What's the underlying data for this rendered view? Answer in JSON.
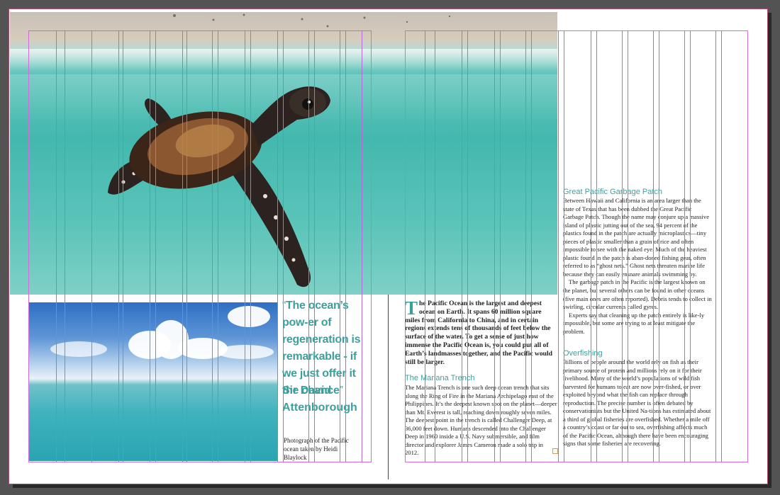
{
  "colors": {
    "accent": "#3d9f9c",
    "pasteboard": "#535353",
    "guides": "#b26ad8"
  },
  "quote": {
    "open": "“",
    "text": "The ocean’s pow-er of regeneration is remarkable - if we just offer it the chance",
    "close": "”",
    "author": "Sir David Attenborough"
  },
  "caption": "Photograph of the Pacific ocean taken by Heidi Blaylock",
  "intro": {
    "dropcap": "T",
    "text": "he Pacific Ocean is the largest and deepest ocean on Earth. It spans 60 million square miles from California to China, and in certain regions extends tens of thousands of feet below the surface of the water. To get a sense of just how immense the Pacific Ocean is, you could put all of Earth’s landmasses together, and the Pacific would still be larger."
  },
  "sections": {
    "mariana": {
      "heading": "The Mariana Trench",
      "body": "The Mariana Trench is one such deep ocean trench that sits along the Ring of Fire in the Mariana Archipelago east of the Philippines. It’s the deepest known spot on the planet—deeper than Mt. Everest is tall, reaching down roughly seven miles. The deepest point in the trench is called Challenger Deep, at 36,000 feet down. Humans descended into the Challenger Deep in 1960 inside a U.S. Navy submersible, and film director and explorer James Cameron made a solo trip in 2012."
    },
    "garbage": {
      "heading": "Great Pacific Garbage Patch",
      "p1": "Between Hawaii and California is an area larger than the state of Texas that has been dubbed the Great Pacific Garbage Patch. Though the name may conjure up a massive island of plastic jutting out of the sea, 94 percent of the plastics found in the patch are actually microplastics—tiny pieces of plastic smaller than a grain of rice and often impossible to see with the naked eye. Much of the heaviest plastic found in the patch is aban-doned fishing gear, often referred to as “ghost nets.” Ghost nets threaten marine life because they can easily ensnare animals swimming by.",
      "p2": "The garbage patch in the Pacific is the largest known on the planet, but several others can be found in other oceans (five main ones are often reported). Debris tends to collect in swirling, circular currents called gyres.",
      "p3": "Experts say that cleaning up the patch entirely is like-ly impossible, but some are trying to at least mitigate the problem."
    },
    "overfishing": {
      "heading": "Overfishing",
      "body": "Billions of people around the world rely on fish as their primary source of protein and millions rely on it for their livelihood. Many of the world’s populations of wild fish harvested for humans to eat are now over-fished, or over exploited beyond what the fish can replace through reproduction. The precise number is often debated by conservationists but the United Na-tions has estimated about a third of global fisheries are overfished. Whether a mile off a country’s coast or far out to sea, overfishing affects much of the Pacific Ocean, although there have been encouraging signs that some fisheries are recovering."
    }
  }
}
